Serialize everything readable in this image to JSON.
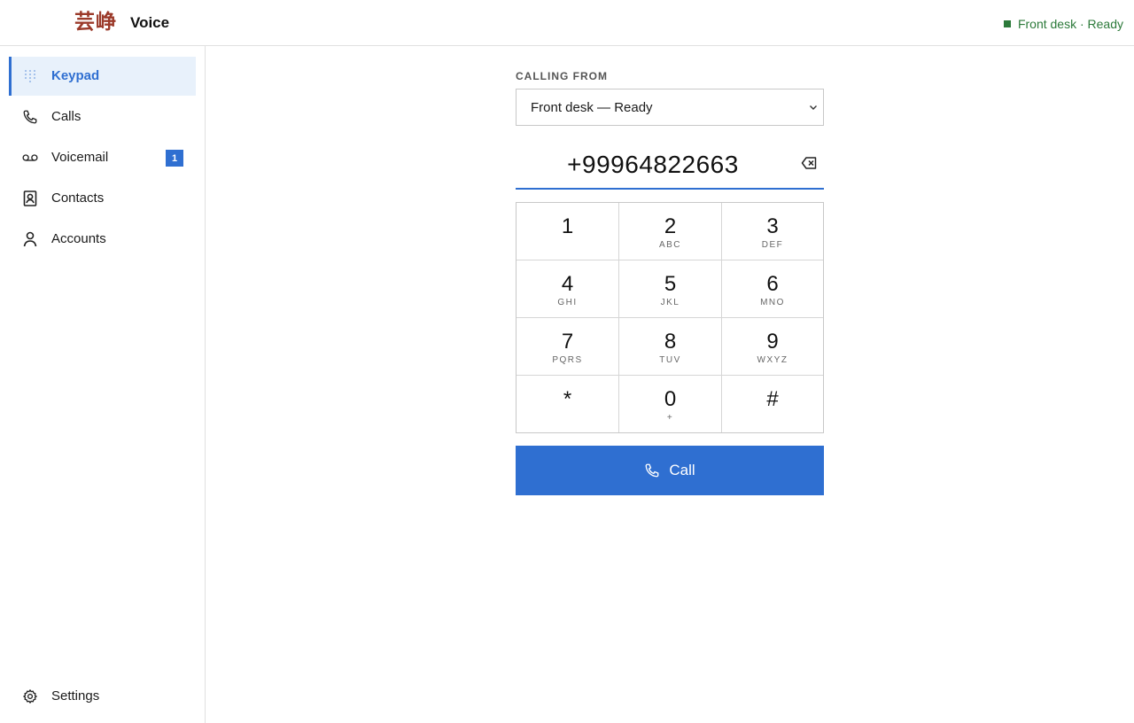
{
  "header": {
    "logo_text": "芸峥",
    "app_title": "Voice",
    "status": "Front desk · Ready",
    "status_color": "#2c7a3a"
  },
  "sidebar": {
    "items": [
      {
        "label": "Keypad",
        "icon": "keypad-icon",
        "active": true
      },
      {
        "label": "Calls",
        "icon": "phone-icon"
      },
      {
        "label": "Voicemail",
        "icon": "voicemail-icon",
        "badge": "1"
      },
      {
        "label": "Contacts",
        "icon": "contacts-icon"
      },
      {
        "label": "Accounts",
        "icon": "person-icon"
      }
    ],
    "settings_label": "Settings",
    "settings_icon": "gear-icon"
  },
  "dialer": {
    "calling_from_label": "CALLING FROM",
    "calling_from_value": "Front desk — Ready",
    "number": "+99964822663",
    "keys": [
      {
        "digit": "1",
        "letters": ""
      },
      {
        "digit": "2",
        "letters": "ABC"
      },
      {
        "digit": "3",
        "letters": "DEF"
      },
      {
        "digit": "4",
        "letters": "GHI"
      },
      {
        "digit": "5",
        "letters": "JKL"
      },
      {
        "digit": "6",
        "letters": "MNO"
      },
      {
        "digit": "7",
        "letters": "PQRS"
      },
      {
        "digit": "8",
        "letters": "TUV"
      },
      {
        "digit": "9",
        "letters": "WXYZ"
      },
      {
        "digit": "*",
        "letters": ""
      },
      {
        "digit": "0",
        "letters": "+"
      },
      {
        "digit": "#",
        "letters": ""
      }
    ],
    "call_label": "Call"
  },
  "colors": {
    "accent": "#2f6fd1",
    "active_bg": "#e8f1fb",
    "logo": "#9b3a2a"
  }
}
